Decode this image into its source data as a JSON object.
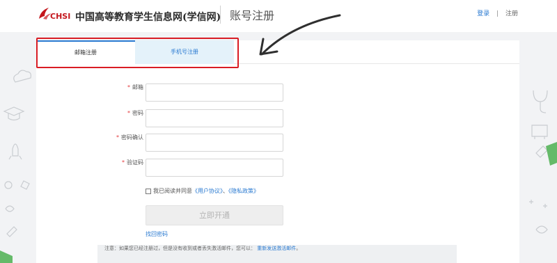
{
  "header": {
    "logo_en": "CHSI",
    "logo_cn": "中国高等教育学生信息网(学信网)",
    "page_title": "账号注册",
    "login_label": "登录",
    "separator": "|",
    "register_label": "注册"
  },
  "tabs": [
    {
      "label": "邮箱注册",
      "active": true
    },
    {
      "label": "手机号注册",
      "active": false
    }
  ],
  "form": {
    "required_mark": "*",
    "fields": [
      {
        "label": "邮箱",
        "value": "",
        "placeholder": ""
      },
      {
        "label": "密码",
        "value": "",
        "placeholder": ""
      },
      {
        "label": "密码确认",
        "value": "",
        "placeholder": ""
      },
      {
        "label": "验证码",
        "value": "",
        "placeholder": ""
      }
    ],
    "agree_prefix": "我已阅读并同意",
    "user_agreement": "《用户协议》",
    "agree_sep": "、",
    "privacy_policy": "《隐私政策》",
    "submit_label": "立即开通",
    "forgot_label": "找回密码"
  },
  "notice": {
    "text": "注意：如果您已经注册过，但是没有收到或者丢失激活邮件，您可以：",
    "resend_label": "重新发送激活邮件",
    "trailing": "。"
  },
  "colors": {
    "accent": "#2a7ad1",
    "brand_red": "#c4161c",
    "highlight_red": "#d91c24",
    "page_bg": "#f2f3f5",
    "active_tab_bg": "#e4f2fa"
  },
  "icons": [
    "chsi-logo-icon",
    "cloud-icon",
    "graduation-cap-icon",
    "rocket-icon",
    "gear-icon",
    "stethoscope-icon",
    "bus-icon",
    "arrow-annotation-icon"
  ]
}
